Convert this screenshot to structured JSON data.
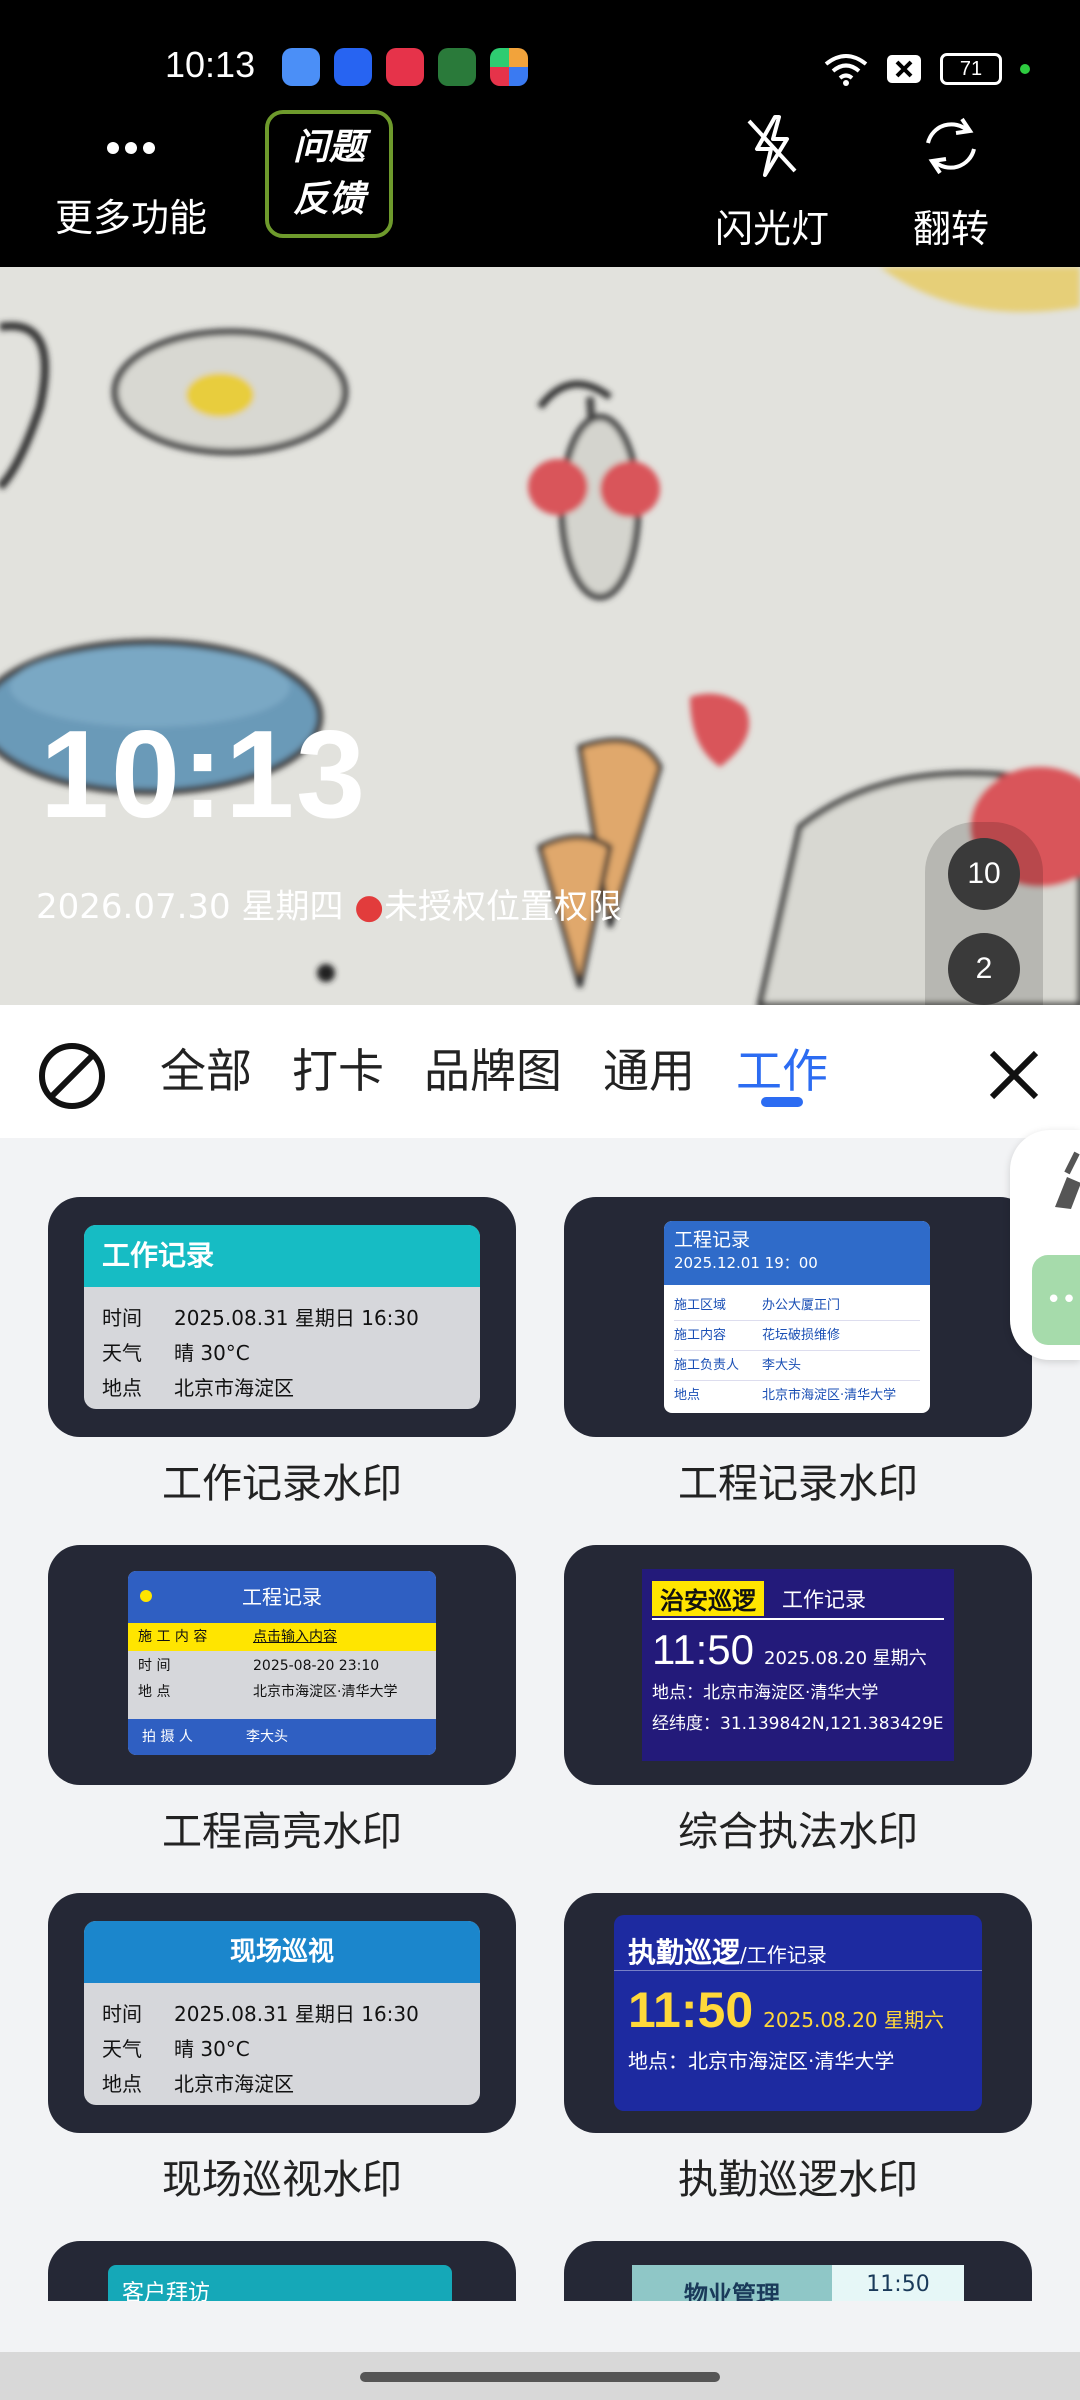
{
  "status_bar": {
    "time": "10:13",
    "battery": "71",
    "app_icon_colors": [
      "#4b8ff7",
      "#2764f2",
      "#e6334a",
      "#2a7a3a",
      "#f2a33b"
    ]
  },
  "top_bar": {
    "more_label": "更多功能",
    "feedback_line1": "问题",
    "feedback_line2": "反馈",
    "flash_label": "闪光灯",
    "flip_label": "翻转"
  },
  "preview": {
    "time": "10:13",
    "date_line": "2026.07.30 星期四",
    "location_text": "未授权位置权限",
    "badge_top": "10",
    "badge_bottom": "2"
  },
  "tabs": {
    "items": [
      "全部",
      "打卡",
      "品牌图",
      "通用",
      "工作"
    ],
    "active": "工作"
  },
  "watermarks": [
    {
      "label": "工作记录水印",
      "title": "工作记录",
      "rows": [
        [
          "时间",
          "2025.08.31 星期日 16:30"
        ],
        [
          "天气",
          "晴 30°C"
        ],
        [
          "地点",
          "北京市海淀区"
        ]
      ]
    },
    {
      "label": "工程记录水印",
      "title": "工程记录",
      "subtitle": "2025.12.01 19：00",
      "rows": [
        [
          "施工区域",
          "办公大厦正门"
        ],
        [
          "施工内容",
          "花坛破损维修"
        ],
        [
          "施工负责人",
          "李大头"
        ],
        [
          "地点",
          "北京市海淀区·清华大学"
        ]
      ]
    },
    {
      "label": "工程高亮水印",
      "title": "工程记录",
      "highlight_key": "施 工 内 容",
      "highlight_val": "点击输入内容",
      "rows": [
        [
          "时          间",
          "2025-08-20 23:10"
        ],
        [
          "地          点",
          "北京市海淀区·清华大学"
        ]
      ],
      "footer_key": "拍     摄     人",
      "footer_val": "李大头"
    },
    {
      "label": "综合执法水印",
      "tag": "治安巡逻",
      "title": "工作记录",
      "time": "11:50",
      "date": "2025.08.20 星期六",
      "loc": "地点：北京市海淀区·清华大学",
      "coords": "经纬度：31.139842N,121.383429E"
    },
    {
      "label": "现场巡视水印",
      "title": "现场巡视",
      "rows": [
        [
          "时间",
          "2025.08.31 星期日 16:30"
        ],
        [
          "天气",
          "晴 30°C"
        ],
        [
          "地点",
          "北京市海淀区"
        ]
      ]
    },
    {
      "label": "执勤巡逻水印",
      "title": "执勤巡逻",
      "title_suffix": "/工作记录",
      "time": "11:50",
      "date": "2025.08.20 星期六",
      "loc": "地点：北京市海淀区·清华大学"
    },
    {
      "title": "客户拜访"
    },
    {
      "title": "物业管理",
      "time": "11:50"
    }
  ]
}
